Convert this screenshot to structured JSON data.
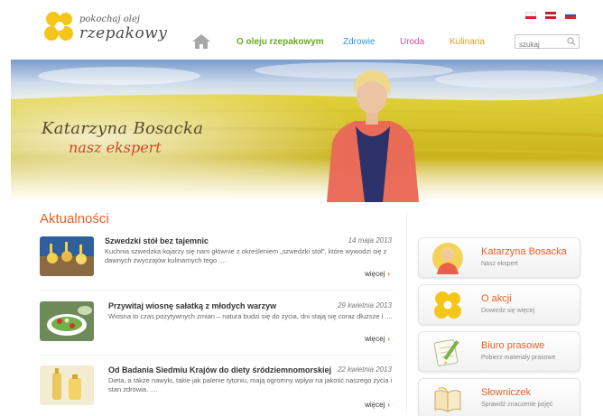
{
  "header": {
    "logo_line1": "pokochaj olej",
    "logo_line2": "rzepakowy",
    "flags": [
      "pl-flag",
      "en-flag",
      "ru-flag"
    ],
    "search_placeholder": "szukaj"
  },
  "nav": {
    "items": [
      {
        "label": "O oleju rzepakowym",
        "color": "#6aa81e"
      },
      {
        "label": "Zdrowie",
        "color": "#2d9ad2"
      },
      {
        "label": "Uroda",
        "color": "#d24fa0"
      },
      {
        "label": "Kulinaria",
        "color": "#e89a1a"
      }
    ]
  },
  "hero": {
    "title": "Katarzyna Bosacka",
    "subtitle": "nasz ekspert"
  },
  "news": {
    "heading": "Aktualności",
    "items": [
      {
        "title": "Szwedzki stół bez tajemnic",
        "date": "14 maja 2013",
        "text": "Kuchnia szwedzka kojarzy się nam głównie z określeniem „szwedzki stół\", które wywodzi się z dawnych zwyczajów kulinarnych tego ....",
        "more": "więcej"
      },
      {
        "title": "Przywitaj wiosnę sałatką z młodych warzyw",
        "date": "29 kwietnia 2013",
        "text": "Wiosna to czas pozytywnych zmian – natura budzi się do życia, dni stają się coraz dłuższe i ....",
        "more": "więcej"
      },
      {
        "title": "Od Badania Siedmiu Krajów do diety śródziemnomorskiej",
        "date": "22 kwietnia 2013",
        "text": "Dieta, a także nawyki, takie jak palenie tytoniu, mają ogromny wpływ na jakość naszego życia i stan zdrowia. ....",
        "more": "więcej"
      }
    ]
  },
  "sidebar": {
    "cards": [
      {
        "title": "Katarzyna Bosacka",
        "sub": "Nasz ekspert",
        "icon": "expert-portrait-icon"
      },
      {
        "title": "O akcji",
        "sub": "Dowiedz się więcej",
        "icon": "flower-logo-icon"
      },
      {
        "title": "Biuro prasowe",
        "sub": "Pobierz materiały prasowe",
        "icon": "notepad-pencil-icon"
      },
      {
        "title": "Słowniczek",
        "sub": "Sprawdź znaczenie pojęć",
        "icon": "open-book-icon"
      }
    ]
  },
  "colors": {
    "accent": "#e8602a",
    "logo_yellow": "#f5c518",
    "nav_green": "#6aa81e"
  }
}
